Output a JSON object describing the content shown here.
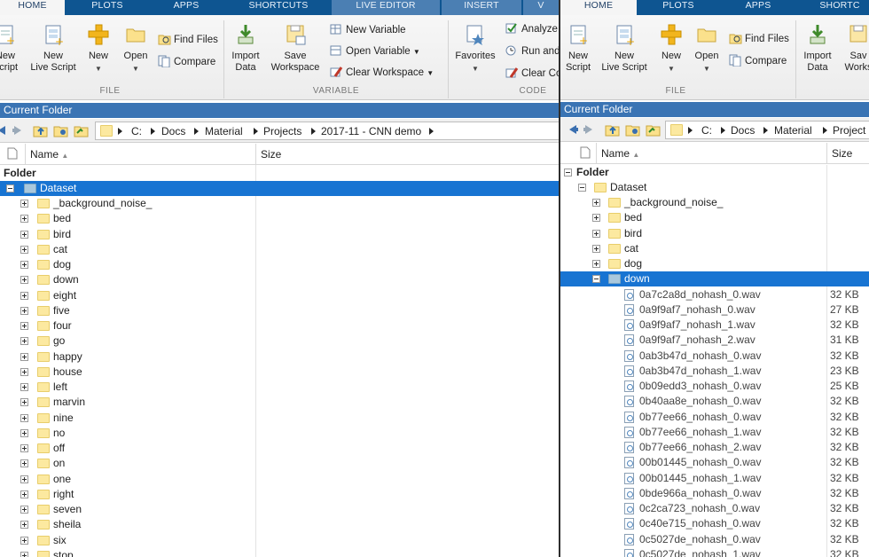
{
  "left": {
    "tabs": [
      "HOME",
      "PLOTS",
      "APPS",
      "SHORTCUTS",
      "LIVE EDITOR",
      "INSERT",
      "V"
    ],
    "toolstrip": {
      "new_script": [
        "New",
        "Script"
      ],
      "new_live_script": [
        "New",
        "Live Script"
      ],
      "new": "New",
      "open": "Open",
      "find_files": "Find Files",
      "compare": "Compare",
      "import_data": [
        "Import",
        "Data"
      ],
      "save_workspace": [
        "Save",
        "Workspace"
      ],
      "new_variable": "New Variable",
      "open_variable": "Open Variable",
      "clear_workspace": "Clear Workspace",
      "favorites": "Favorites",
      "analyze": "Analyze",
      "run_and": "Run and",
      "clear_c": "Clear Co",
      "sections": {
        "file": "FILE",
        "variable": "VARIABLE",
        "code": "CODE"
      }
    },
    "current_folder": "Current Folder",
    "path": [
      "C:",
      "Docs",
      "Material",
      "Projects",
      "2017-11 - CNN demo"
    ],
    "columns": {
      "name": "Name",
      "size": "Size"
    },
    "folder_label": "Folder",
    "tree": {
      "root": "Dataset",
      "children": [
        "_background_noise_",
        "bed",
        "bird",
        "cat",
        "dog",
        "down",
        "eight",
        "five",
        "four",
        "go",
        "happy",
        "house",
        "left",
        "marvin",
        "nine",
        "no",
        "off",
        "on",
        "one",
        "right",
        "seven",
        "sheila",
        "six",
        "stop"
      ]
    }
  },
  "right": {
    "tabs": [
      "HOME",
      "PLOTS",
      "APPS",
      "SHORTC"
    ],
    "toolstrip": {
      "new_script": [
        "New",
        "Script"
      ],
      "new_live_script": [
        "New",
        "Live Script"
      ],
      "new": "New",
      "open": "Open",
      "find_files": "Find Files",
      "compare": "Compare",
      "import_data": [
        "Import",
        "Data"
      ],
      "save_workspace": [
        "Sav",
        "Works"
      ],
      "sections": {
        "file": "FILE"
      }
    },
    "current_folder": "Current Folder",
    "path": [
      "C:",
      "Docs",
      "Material",
      "Project"
    ],
    "columns": {
      "name": "Name",
      "size": "Size"
    },
    "folder_label": "Folder",
    "tree": {
      "root": "Dataset",
      "children": [
        "_background_noise_",
        "bed",
        "bird",
        "cat",
        "dog"
      ],
      "expanded": "down",
      "files": [
        {
          "name": "0a7c2a8d_nohash_0.wav",
          "size": "32 KB"
        },
        {
          "name": "0a9f9af7_nohash_0.wav",
          "size": "27 KB"
        },
        {
          "name": "0a9f9af7_nohash_1.wav",
          "size": "32 KB"
        },
        {
          "name": "0a9f9af7_nohash_2.wav",
          "size": "31 KB"
        },
        {
          "name": "0ab3b47d_nohash_0.wav",
          "size": "32 KB"
        },
        {
          "name": "0ab3b47d_nohash_1.wav",
          "size": "23 KB"
        },
        {
          "name": "0b09edd3_nohash_0.wav",
          "size": "25 KB"
        },
        {
          "name": "0b40aa8e_nohash_0.wav",
          "size": "32 KB"
        },
        {
          "name": "0b77ee66_nohash_0.wav",
          "size": "32 KB"
        },
        {
          "name": "0b77ee66_nohash_1.wav",
          "size": "32 KB"
        },
        {
          "name": "0b77ee66_nohash_2.wav",
          "size": "32 KB"
        },
        {
          "name": "00b01445_nohash_0.wav",
          "size": "32 KB"
        },
        {
          "name": "00b01445_nohash_1.wav",
          "size": "32 KB"
        },
        {
          "name": "0bde966a_nohash_0.wav",
          "size": "32 KB"
        },
        {
          "name": "0c2ca723_nohash_0.wav",
          "size": "32 KB"
        },
        {
          "name": "0c40e715_nohash_0.wav",
          "size": "32 KB"
        },
        {
          "name": "0c5027de_nohash_0.wav",
          "size": "32 KB"
        },
        {
          "name": "0c5027de_nohash_1.wav",
          "size": "32 KB"
        }
      ]
    }
  },
  "colors": {
    "tabbar": "#0e5591",
    "header": "#3a74b4",
    "selection": "#1874d2",
    "folder": "#fce9a0"
  }
}
